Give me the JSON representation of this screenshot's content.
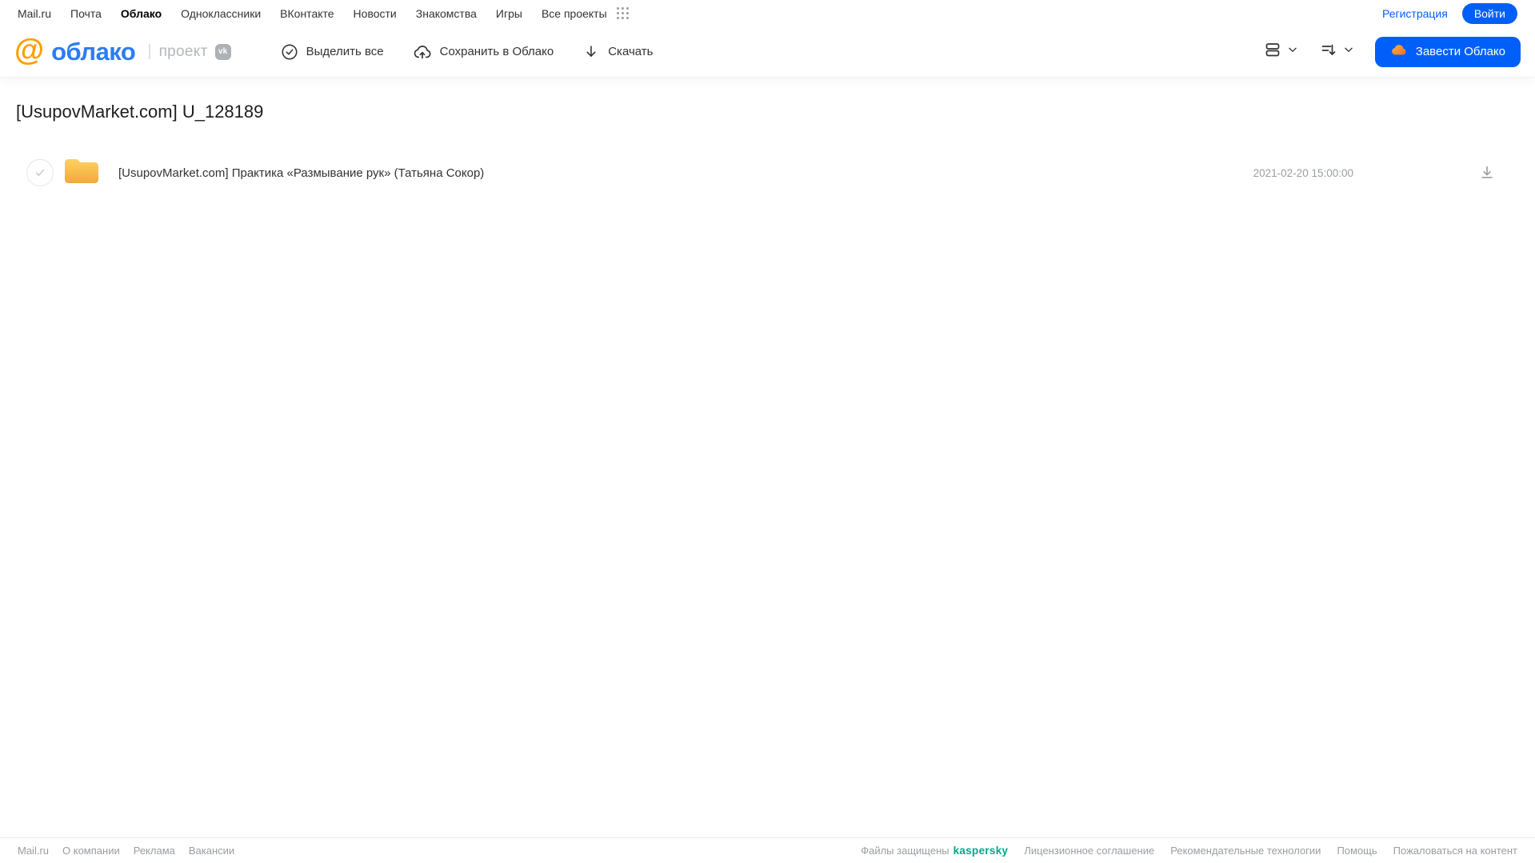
{
  "topbar": {
    "links": [
      "Mail.ru",
      "Почта",
      "Облако",
      "Одноклассники",
      "ВКонтакте",
      "Новости",
      "Знакомства",
      "Игры",
      "Все проекты"
    ],
    "register_label": "Регистрация",
    "login_label": "Войти"
  },
  "header": {
    "logo_at": "@",
    "logo_text": "облако",
    "project_label": "проект",
    "vk_badge": "vk",
    "select_all_label": "Выделить все",
    "save_to_cloud_label": "Сохранить в Облако",
    "download_label": "Скачать",
    "get_cloud_label": "Завести Облако"
  },
  "main": {
    "title": "[UsupovMarket.com] U_128189",
    "files": [
      {
        "type": "folder",
        "name": "[UsupovMarket.com] Практика «Размывание рук» (Татьяна Сокор)",
        "date": "2021-02-20 15:00:00"
      }
    ]
  },
  "footer": {
    "links_left": [
      "Mail.ru",
      "О компании",
      "Реклама",
      "Вакансии"
    ],
    "protected_label": "Файлы защищены",
    "kaspersky_label": "kaspersky",
    "links_right": [
      "Лицензионное соглашение",
      "Рекомендательные технологии",
      "Помощь",
      "Пожаловаться на контент"
    ]
  },
  "colors": {
    "accent_blue": "#005ff9",
    "logo_orange": "#ff9e00",
    "logo_blue": "#2b7cf6",
    "kaspersky_teal": "#00a88e",
    "folder_yellow_top": "#ffd162",
    "folder_yellow_bottom": "#f2a93b"
  }
}
